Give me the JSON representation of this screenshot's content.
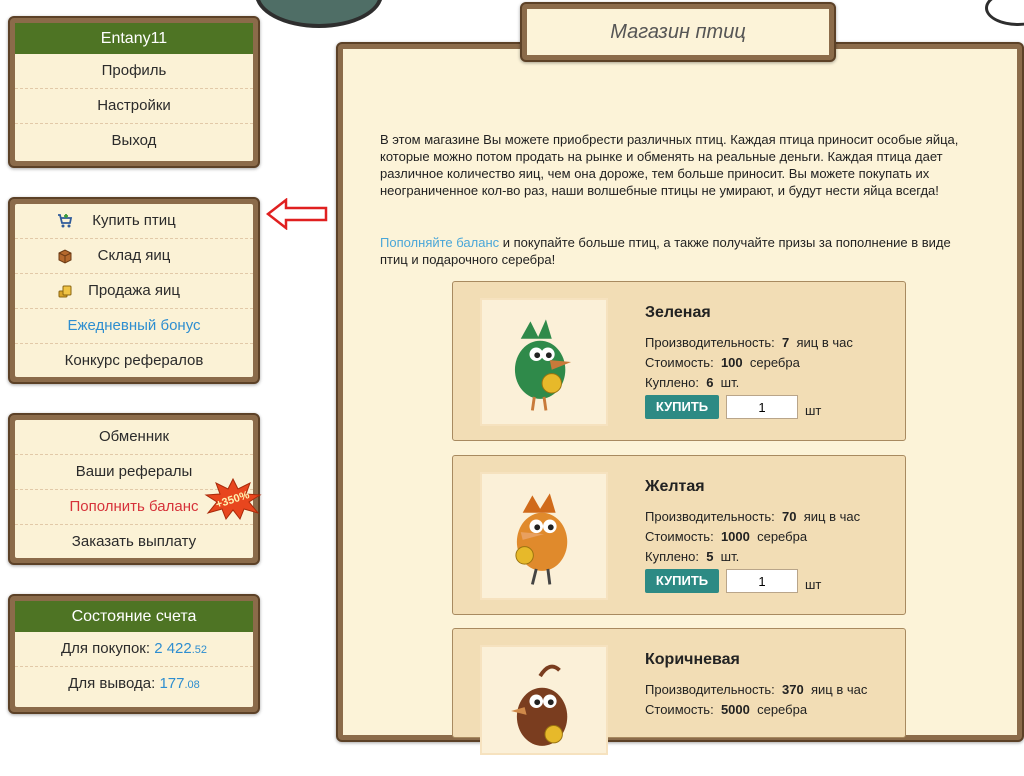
{
  "user": {
    "name": "Entany11",
    "menu": [
      "Профиль",
      "Настройки",
      "Выход"
    ]
  },
  "shop_menu": [
    {
      "label": "Купить птиц",
      "icon": "cart-icon"
    },
    {
      "label": "Склад яиц",
      "icon": "box-icon"
    },
    {
      "label": "Продажа яиц",
      "icon": "coins-icon"
    },
    {
      "label": "Ежедневный бонус"
    },
    {
      "label": "Конкурс рефералов"
    }
  ],
  "finance_menu": [
    "Обменник",
    "Ваши рефералы",
    "Пополнить баланс",
    "Заказать выплату"
  ],
  "bonus_badge": "+350%",
  "account": {
    "title": "Состояние счета",
    "purchase_label": "Для покупок:",
    "purchase_int": "2 422",
    "purchase_cents": ".52",
    "withdraw_label": "Для вывода:",
    "withdraw_int": "177",
    "withdraw_cents": ".08"
  },
  "page": {
    "title": "Магазин птиц",
    "intro": "В этом магазине Вы можете приобрести различных птиц. Каждая птица приносит особые яйца, которые можно потом продать на рынке и обменять на реальные деньги. Каждая птица дает различное количество яиц, чем она дороже, тем больше приносит. Вы можете покупать их неограниченное кол-во раз, наши волшебные птицы не умирают, и будут нести яйца всегда!",
    "topup_link": "Пополняйте баланс",
    "topup_rest": " и покупайте больше птиц, а также получайте призы за пополнение в виде птиц и подарочного серебра!"
  },
  "labels": {
    "productivity": "Производительность:",
    "eggs_per_hour": "яиц в час",
    "cost": "Стоимость:",
    "silver": "серебра",
    "bought": "Куплено:",
    "pcs": "шт.",
    "buy": "КУПИТЬ",
    "unit": "шт"
  },
  "birds": [
    {
      "name": "Зеленая",
      "productivity": "7",
      "cost": "100",
      "bought": "6",
      "qty": "1",
      "color": "#2f8a4a"
    },
    {
      "name": "Желтая",
      "productivity": "70",
      "cost": "1000",
      "bought": "5",
      "qty": "1",
      "color": "#e08a2c"
    },
    {
      "name": "Коричневая",
      "productivity": "370",
      "cost": "5000",
      "color": "#7a3d1f"
    }
  ],
  "colors": {
    "panel_header": "#4e7424",
    "link": "#2e8ed0",
    "danger": "#d6323a",
    "buy_button": "#2d8a84"
  }
}
